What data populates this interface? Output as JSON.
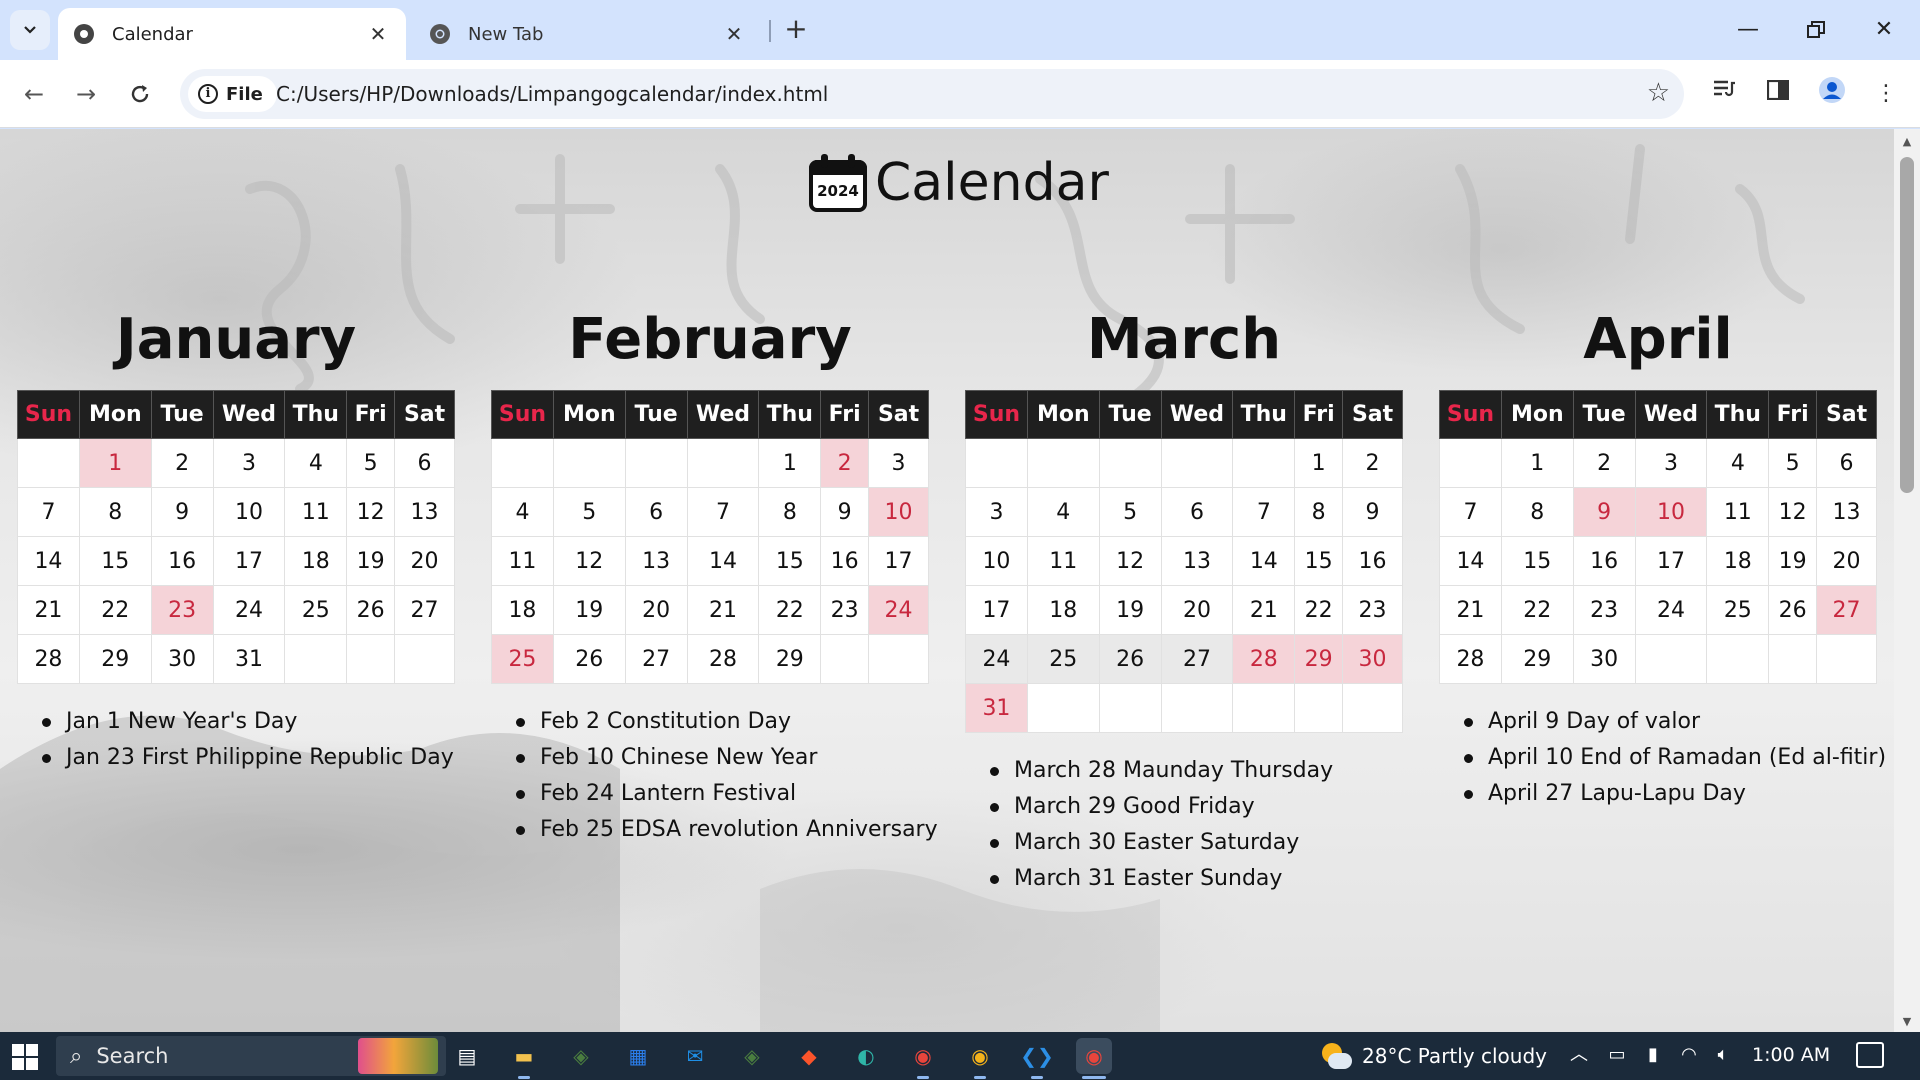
{
  "browser": {
    "tabs": [
      {
        "title": "Calendar",
        "active": true
      },
      {
        "title": "New Tab",
        "active": false
      }
    ],
    "chip_label": "File",
    "url": "C:/Users/HP/Downloads/Limpangogcalendar/index.html"
  },
  "page": {
    "title": "Calendar",
    "icon_year": "2024",
    "weekdays": [
      "Sun",
      "Mon",
      "Tue",
      "Wed",
      "Thu",
      "Fri",
      "Sat"
    ],
    "colors": {
      "holiday_bg": "#f5d3d8",
      "holiday_text": "#c8283f",
      "sunday_header": "#e8264b",
      "header_bg": "#1f1f1f",
      "holy_week_bg": "#e9e9e9"
    },
    "months": [
      {
        "name": "January",
        "rows": [
          [
            "",
            "1",
            "2",
            "3",
            "4",
            "5",
            "6"
          ],
          [
            "7",
            "8",
            "9",
            "10",
            "11",
            "12",
            "13"
          ],
          [
            "14",
            "15",
            "16",
            "17",
            "18",
            "19",
            "20"
          ],
          [
            "21",
            "22",
            "23",
            "24",
            "25",
            "26",
            "27"
          ],
          [
            "28",
            "29",
            "30",
            "31",
            "",
            "",
            ""
          ]
        ],
        "holidays": [
          "1",
          "23"
        ],
        "shaded": [],
        "events": [
          "Jan 1 New Year's Day",
          "Jan 23 First Philippine Republic Day"
        ]
      },
      {
        "name": "February",
        "rows": [
          [
            "",
            "",
            "",
            "",
            "1",
            "2",
            "3"
          ],
          [
            "4",
            "5",
            "6",
            "7",
            "8",
            "9",
            "10"
          ],
          [
            "11",
            "12",
            "13",
            "14",
            "15",
            "16",
            "17"
          ],
          [
            "18",
            "19",
            "20",
            "21",
            "22",
            "23",
            "24"
          ],
          [
            "25",
            "26",
            "27",
            "28",
            "29",
            "",
            ""
          ]
        ],
        "holidays": [
          "2",
          "10",
          "24",
          "25"
        ],
        "shaded": [],
        "events": [
          "Feb 2 Constitution Day",
          "Feb 10 Chinese New Year",
          "Feb 24 Lantern Festival",
          "Feb 25 EDSA revolution Anniversary"
        ]
      },
      {
        "name": "March",
        "rows": [
          [
            "",
            "",
            "",
            "",
            "",
            "1",
            "2"
          ],
          [
            "3",
            "4",
            "5",
            "6",
            "7",
            "8",
            "9"
          ],
          [
            "10",
            "11",
            "12",
            "13",
            "14",
            "15",
            "16"
          ],
          [
            "17",
            "18",
            "19",
            "20",
            "21",
            "22",
            "23"
          ],
          [
            "24",
            "25",
            "26",
            "27",
            "28",
            "29",
            "30"
          ],
          [
            "31",
            "",
            "",
            "",
            "",
            "",
            ""
          ]
        ],
        "holidays": [
          "28",
          "29",
          "30",
          "31"
        ],
        "shaded": [
          "24",
          "25",
          "26",
          "27"
        ],
        "events": [
          "March 28 Maunday Thursday",
          "March 29 Good Friday",
          "March 30 Easter Saturday",
          "March 31 Easter Sunday"
        ]
      },
      {
        "name": "April",
        "rows": [
          [
            "",
            "1",
            "2",
            "3",
            "4",
            "5",
            "6"
          ],
          [
            "7",
            "8",
            "9",
            "10",
            "11",
            "12",
            "13"
          ],
          [
            "14",
            "15",
            "16",
            "17",
            "18",
            "19",
            "20"
          ],
          [
            "21",
            "22",
            "23",
            "24",
            "25",
            "26",
            "27"
          ],
          [
            "28",
            "29",
            "30",
            "",
            "",
            "",
            ""
          ]
        ],
        "holidays": [
          "9",
          "10",
          "27"
        ],
        "shaded": [],
        "events": [
          "April 9 Day of valor",
          "April 10 End of Ramadan (Ed al-fitir)",
          "April 27 Lapu-Lapu Day"
        ]
      }
    ]
  },
  "taskbar": {
    "search_label": "Search",
    "weather": "28°C  Partly cloudy",
    "time": "1:00 AM",
    "apps": [
      "task-view-icon",
      "file-explorer-icon",
      "app-icon",
      "store-icon",
      "mail-icon",
      "app-icon",
      "brave-browser-icon",
      "edge-browser-icon",
      "chrome-browser-icon",
      "chrome-canary-icon",
      "vscode-icon",
      "chrome-browser-icon"
    ]
  }
}
